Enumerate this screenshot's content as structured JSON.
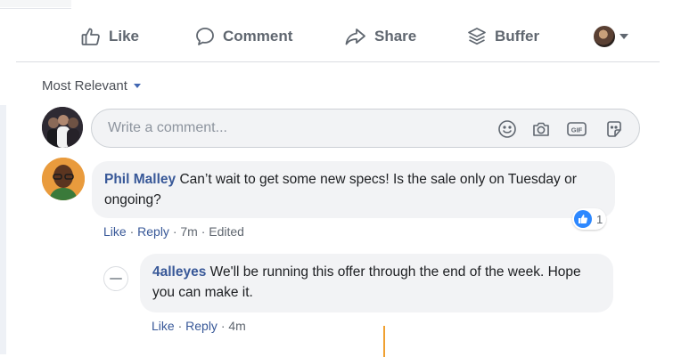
{
  "actions": {
    "like": "Like",
    "comment": "Comment",
    "share": "Share",
    "buffer": "Buffer"
  },
  "sort": {
    "label": "Most Relevant"
  },
  "composer": {
    "placeholder": "Write a comment..."
  },
  "comments": [
    {
      "author": "Phil Malley",
      "text": "Can’t wait to get some new specs! Is the sale only on Tuesday or ongoing?",
      "like": "Like",
      "reply": "Reply",
      "info": " · 7m · Edited",
      "reactions": "1"
    },
    {
      "author": "4alleyes",
      "text": "We'll be running this offer through the end of the week. Hope you can make it.",
      "like": "Like",
      "reply": "Reply",
      "info": " · 4m"
    }
  ],
  "colors": {
    "link": "#385898",
    "like_reaction": "#2d88ff",
    "bubble": "#f2f3f5",
    "icon_gray": "#606770"
  },
  "icons": [
    "thumbs-up-icon",
    "comment-icon",
    "share-icon",
    "buffer-icon",
    "smiley-icon",
    "camera-icon",
    "gif-icon",
    "sticker-icon"
  ]
}
